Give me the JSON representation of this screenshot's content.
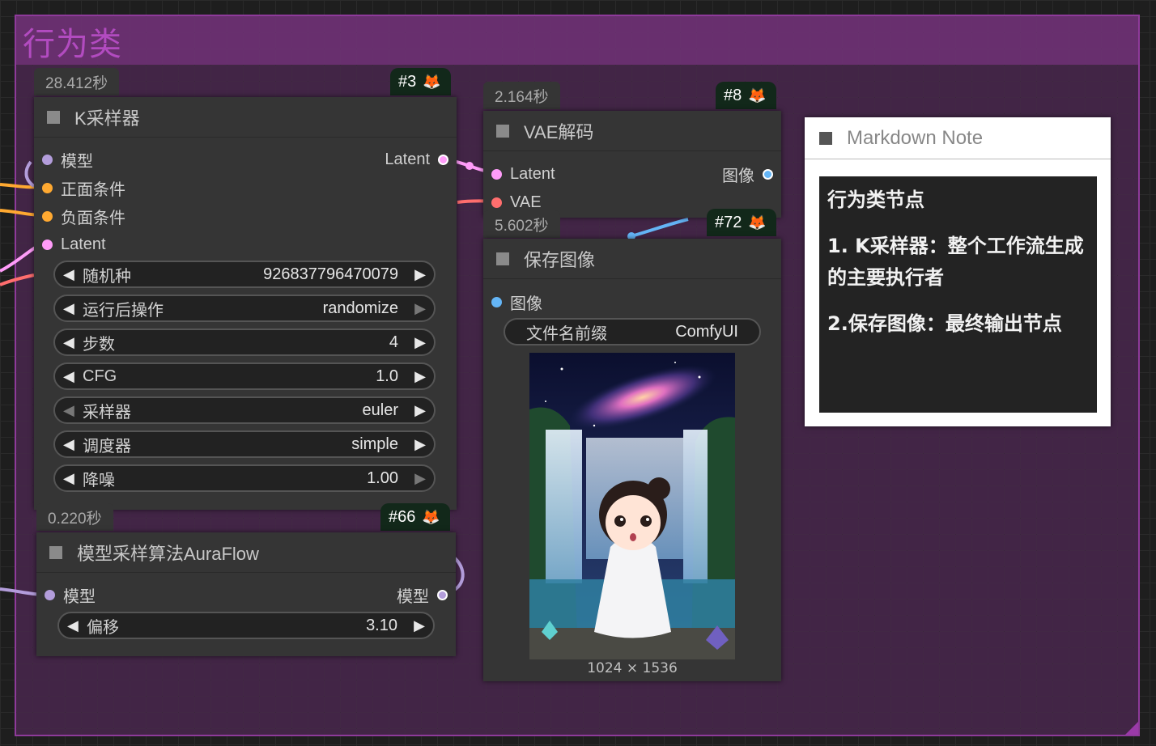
{
  "group": {
    "title": "行为类"
  },
  "colors": {
    "model_slot": "#b39ddb",
    "conditioning_slot": "#ffa931",
    "latent_slot": "#ff9cf9",
    "vae_slot": "#ff6e6e",
    "image_slot": "#64b5f6"
  },
  "ksampler": {
    "timing": "28.412秒",
    "badge": "#3",
    "title": "K采样器",
    "inputs": [
      "模型",
      "正面条件",
      "负面条件",
      "Latent"
    ],
    "output": "Latent",
    "widgets": [
      {
        "label": "随机种",
        "value": "926837796470079"
      },
      {
        "label": "运行后操作",
        "value": "randomize"
      },
      {
        "label": "步数",
        "value": "4"
      },
      {
        "label": "CFG",
        "value": "1.0"
      },
      {
        "label": "采样器",
        "value": "euler"
      },
      {
        "label": "调度器",
        "value": "simple"
      },
      {
        "label": "降噪",
        "value": "1.00"
      }
    ]
  },
  "auraflow": {
    "timing": "0.220秒",
    "badge": "#66",
    "title": "模型采样算法AuraFlow",
    "input": "模型",
    "output": "模型",
    "widget": {
      "label": "偏移",
      "value": "3.10"
    }
  },
  "vae_decode": {
    "timing": "2.164秒",
    "badge": "#8",
    "title": "VAE解码",
    "inputs": [
      "Latent",
      "VAE"
    ],
    "output": "图像"
  },
  "save_image": {
    "timing": "5.602秒",
    "badge": "#72",
    "title": "保存图像",
    "input": "图像",
    "widget": {
      "label": "文件名前缀",
      "value": "ComfyUI"
    },
    "image_size": "1024 × 1536"
  },
  "markdown_note": {
    "title": "Markdown Note",
    "lines": [
      "行为类节点",
      "1. K采样器：整个工作流生成的主要执行者",
      "2.保存图像：最终输出节点"
    ]
  }
}
